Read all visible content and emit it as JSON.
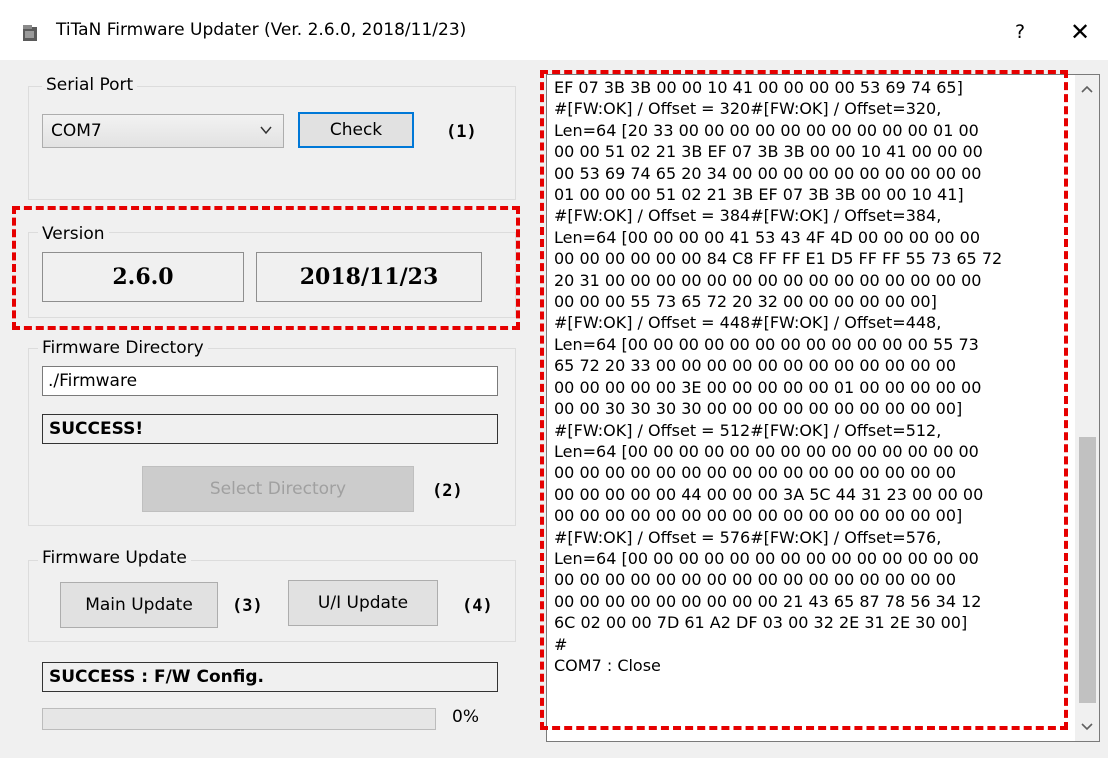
{
  "window": {
    "title": "TiTaN Firmware Updater (Ver. 2.6.0, 2018/11/23)",
    "help": "?",
    "close": "✕"
  },
  "serial_port": {
    "label": "Serial Port",
    "selected": "COM7",
    "check_label": "Check",
    "marker": "(1)"
  },
  "version": {
    "label": "Version",
    "number": "2.6.0",
    "date": "2018/11/23"
  },
  "firmware_directory": {
    "label": "Firmware Directory",
    "path": "./Firmware",
    "status": "SUCCESS!",
    "select_label": "Select Directory",
    "marker": "(2)"
  },
  "firmware_update": {
    "label": "Firmware Update",
    "main_label": "Main Update",
    "main_marker": "(3)",
    "ui_label": "U/I Update",
    "ui_marker": "(4)"
  },
  "status": {
    "message": "SUCCESS : F/W Config.",
    "progress_percent": 0,
    "progress_text": "0%"
  },
  "log": {
    "text": "EF 07 3B 3B 00 00 10 41 00 00 00 00 53 69 74 65]\n#[FW:OK] / Offset = 320#[FW:OK] / Offset=320,\nLen=64 [20 33 00 00 00 00 00 00 00 00 00 00 01 00\n00 00 51 02 21 3B EF 07 3B 3B 00 00 10 41 00 00 00\n00 53 69 74 65 20 34 00 00 00 00 00 00 00 00 00 00\n01 00 00 00 51 02 21 3B EF 07 3B 3B 00 00 10 41]\n#[FW:OK] / Offset = 384#[FW:OK] / Offset=384,\nLen=64 [00 00 00 00 41 53 43 4F 4D 00 00 00 00 00\n00 00 00 00 00 00 84 C8 FF FF E1 D5 FF FF 55 73 65 72\n20 31 00 00 00 00 00 00 00 00 00 00 00 00 00 00 00\n00 00 00 55 73 65 72 20 32 00 00 00 00 00 00]\n#[FW:OK] / Offset = 448#[FW:OK] / Offset=448,\nLen=64 [00 00 00 00 00 00 00 00 00 00 00 00 55 73\n65 72 20 33 00 00 00 00 00 00 00 00 00 00 00 00\n00 00 00 00 00 3E 00 00 00 00 00 01 00 00 00 00 00\n00 00 30 30 30 30 00 00 00 00 00 00 00 00 00 00]\n#[FW:OK] / Offset = 512#[FW:OK] / Offset=512,\nLen=64 [00 00 00 00 00 00 00 00 00 00 00 00 00 00\n00 00 00 00 00 00 00 00 00 00 00 00 00 00 00 00\n00 00 00 00 00 44 00 00 00 3A 5C 44 31 23 00 00 00\n00 00 00 00 00 00 00 00 00 00 00 00 00 00 00 00]\n#[FW:OK] / Offset = 576#[FW:OK] / Offset=576,\nLen=64 [00 00 00 00 00 00 00 00 00 00 00 00 00 00\n00 00 00 00 00 00 00 00 00 00 00 00 00 00 00 00\n00 00 00 00 00 00 00 00 00 21 43 65 87 78 56 34 12\n6C 02 00 00 7D 61 A2 DF 03 00 32 2E 31 2E 30 00]\n#\nCOM7 : Close"
  },
  "colors": {
    "highlight_border": "#e60000",
    "focus_border": "#0078d7",
    "window_bg": "#f0f0f0"
  }
}
